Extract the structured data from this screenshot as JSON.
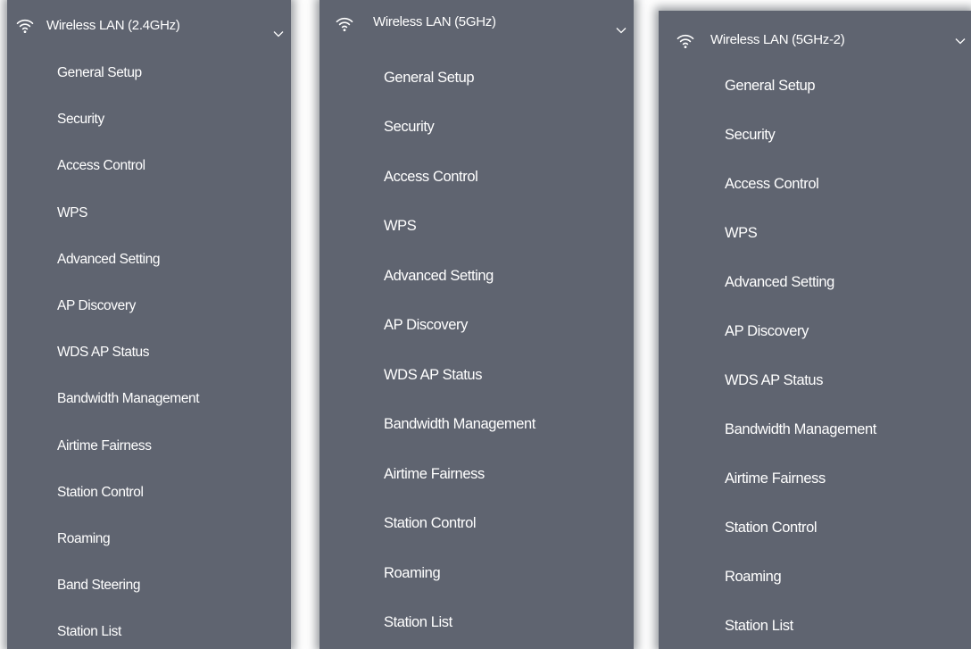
{
  "panels": [
    {
      "title": "Wireless LAN (2.4GHz)",
      "icon": "wifi-icon",
      "items": [
        "General Setup",
        "Security",
        "Access Control",
        "WPS",
        "Advanced Setting",
        "AP Discovery",
        "WDS AP Status",
        "Bandwidth Management",
        "Airtime Fairness",
        "Station Control",
        "Roaming",
        "Band Steering",
        "Station List"
      ]
    },
    {
      "title": "Wireless LAN (5GHz)",
      "icon": "wifi-icon",
      "items": [
        "General Setup",
        "Security",
        "Access Control",
        "WPS",
        "Advanced Setting",
        "AP Discovery",
        "WDS AP Status",
        "Bandwidth Management",
        "Airtime Fairness",
        "Station Control",
        "Roaming",
        "Station List"
      ]
    },
    {
      "title": "Wireless LAN (5GHz-2)",
      "icon": "wifi-icon",
      "items": [
        "General Setup",
        "Security",
        "Access Control",
        "WPS",
        "Advanced Setting",
        "AP Discovery",
        "WDS AP Status",
        "Bandwidth Management",
        "Airtime Fairness",
        "Station Control",
        "Roaming",
        "Station List"
      ]
    }
  ],
  "colors": {
    "panel_bg": "#5f6470",
    "text": "#ffffff"
  }
}
